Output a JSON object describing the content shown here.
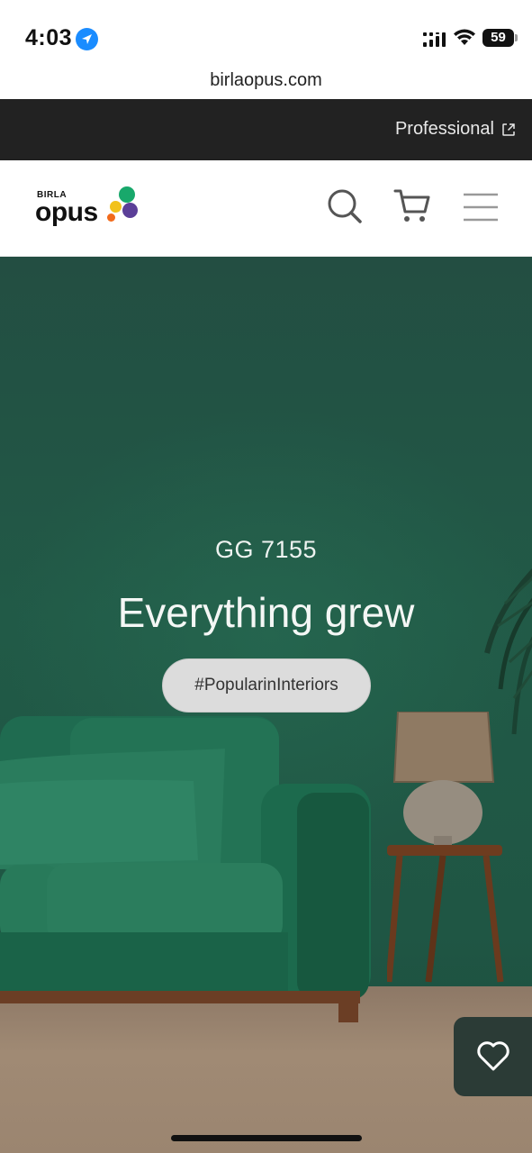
{
  "status_bar": {
    "time": "4:03",
    "battery": "59",
    "icons": [
      "location-arrow-icon",
      "cellular-signal-icon",
      "wifi-icon",
      "battery-icon"
    ]
  },
  "browser": {
    "url": "birlaopus.com"
  },
  "pro_bar": {
    "label": "Professional",
    "icon": "external-link-icon"
  },
  "header": {
    "logo": {
      "small": "BIRLA",
      "main": "opus"
    },
    "icons": [
      "search-icon",
      "cart-icon",
      "menu-icon"
    ]
  },
  "hero": {
    "shade_code": "GG 7155",
    "title": "Everything grew",
    "tag": "#PopularinInteriors"
  },
  "favorite": {
    "icon": "heart-icon"
  },
  "colors": {
    "hero_green": "#215a47",
    "pro_bar": "#222222",
    "tag_bg": "#dcdcdc",
    "fav_bg": "#2b3b36",
    "logo_green": "#18a86b",
    "logo_yellow": "#f2c21a",
    "logo_orange": "#f26a1b",
    "logo_purple": "#5b3f98"
  }
}
